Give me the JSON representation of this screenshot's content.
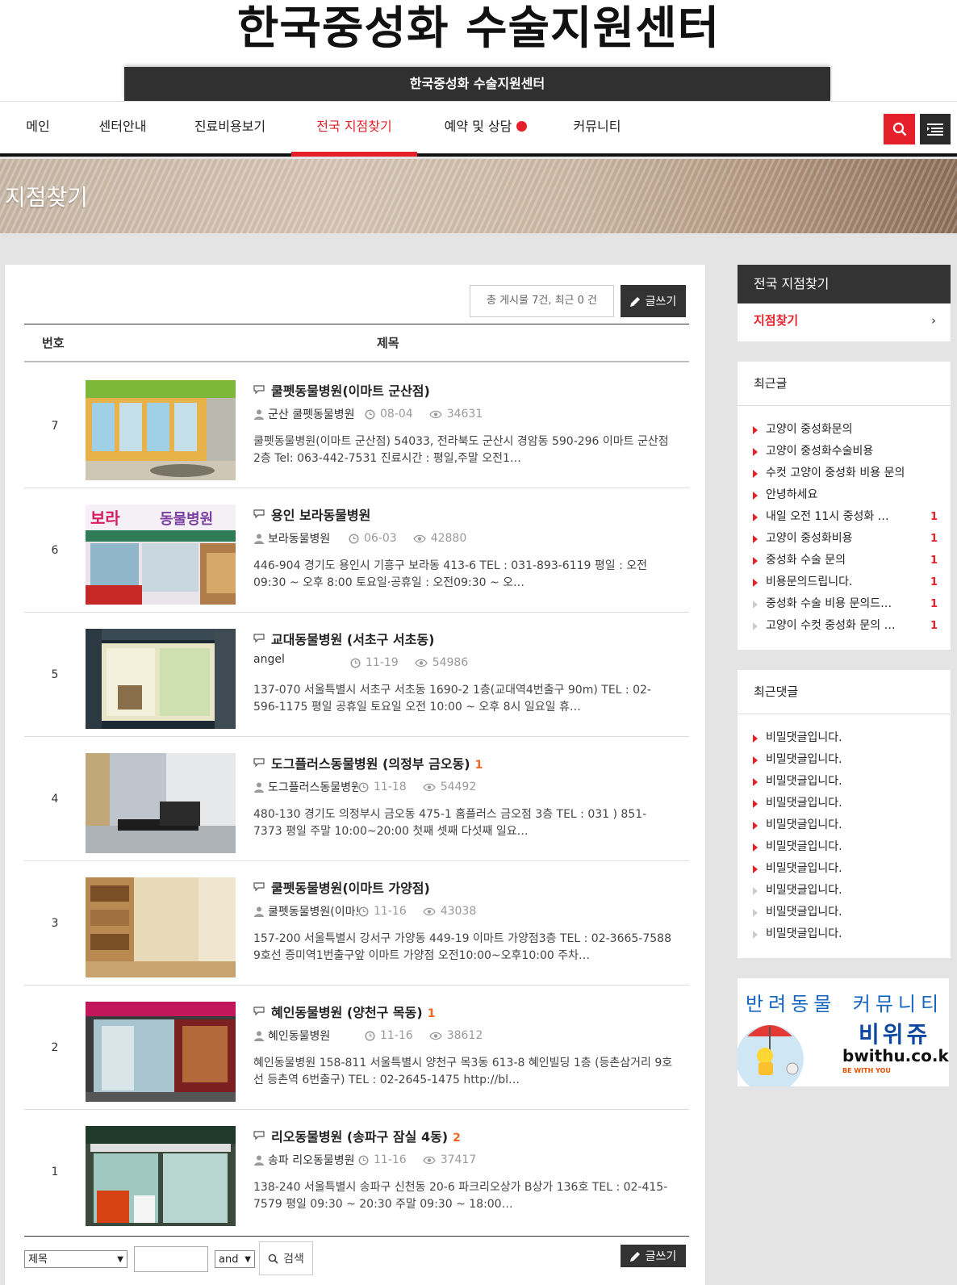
{
  "site": {
    "logo": "한국중성화 수술지원센터",
    "sub_title": "한국중성화 수술지원센터"
  },
  "nav": {
    "items": [
      {
        "label": "메인",
        "active": false
      },
      {
        "label": "센터안내",
        "active": false
      },
      {
        "label": "진료비용보기",
        "active": false
      },
      {
        "label": "전국 지점찾기",
        "active": true
      },
      {
        "label": "예약 및 상담",
        "active": false
      },
      {
        "label": "커뮤니티",
        "active": false
      }
    ],
    "search_icon": "search-icon",
    "menu_icon": "menu-icon"
  },
  "banner": {
    "title": "지점찾기"
  },
  "board": {
    "count_text": "총 게시물 7건, 최근 0 건",
    "write_label": "글쓰기",
    "col_num": "번호",
    "col_title": "제목",
    "posts": [
      {
        "num": "7",
        "title": "쿨펫동물병원(이마트 군산점)",
        "comments": "",
        "author": "군산 쿨펫동물병원",
        "date": "08-04",
        "hits": "34631",
        "summary": "쿨펫동물병원(이마트 군산점) 54033, 전라북도 군산시 경암동 590-296 이마트 군산점 2층 Tel: 063-442-7531 진료시간 : 평일,주말 오전1…"
      },
      {
        "num": "6",
        "title": "용인 보라동물병원",
        "comments": "",
        "author": "보라동물병원",
        "date": "06-03",
        "hits": "42880",
        "summary": "446-904 경기도 용인시 기흥구 보라동 413-6 TEL : 031-893-6119 평일 : 오전 09:30 ~ 오후 8:00 토요일·공휴일 : 오전09:30 ~ 오…"
      },
      {
        "num": "5",
        "title": "교대동물병원 (서초구 서초동)",
        "comments": "",
        "author": "angel",
        "date": "11-19",
        "hits": "54986",
        "summary": "137-070 서울특별시 서초구 서초동 1690-2 1층(교대역4번출구 90m) TEL : 02-596-1175 평일 공휴일 토요일 오전 10:00 ~ 오후 8시 일요일 휴…"
      },
      {
        "num": "4",
        "title": "도그플러스동물병원 (의정부 금오동)",
        "comments": "1",
        "author": "도그플러스동물병원",
        "date": "11-18",
        "hits": "54492",
        "summary": "480-130 경기도 의정부시 금오동 475-1 홈플러스 금오점 3층 TEL : 031 ) 851-7373 평일 주말 10:00~20:00 첫째 셋째 다섯째 일요…"
      },
      {
        "num": "3",
        "title": "쿨펫동물병원(이마트 가양점)",
        "comments": "",
        "author": "쿨펫동물병원(이마트 가양점)",
        "date": "11-16",
        "hits": "43038",
        "summary": "157-200 서울특별시 강서구 가양동 449-19 이마트 가양점3층 TEL : 02-3665-7588 9호선 증미역1번출구앞 이마트 가양점 오전10:00~오후10:00 주차…"
      },
      {
        "num": "2",
        "title": "혜인동물병원 (양천구 목동)",
        "comments": "1",
        "author": "혜인동물병원",
        "date": "11-16",
        "hits": "38612",
        "summary": "혜인동물병원 158-811 서울특별시 양천구 목3동 613-8 혜인빌딩 1층 (등촌삼거리 9호선 등촌역 6번출구) TEL : 02-2645-1475 http://bl…"
      },
      {
        "num": "1",
        "title": "리오동물병원 (송파구 잠실 4동)",
        "comments": "2",
        "author": "송파 리오동물병원",
        "date": "11-16",
        "hits": "37417",
        "summary": "138-240 서울특별시 송파구 신천동 20-6 파크리오상가 B상가 136호 TEL : 02-415-7579 평일 09:30 ~ 20:30 주말 09:30 ~ 18:00…"
      }
    ],
    "search": {
      "field_option": "제목",
      "op_option": "and",
      "query": "",
      "button": "검색"
    }
  },
  "sidebar": {
    "branch": {
      "title": "전국 지점찾기",
      "item": "지점찾기"
    },
    "recent_posts": {
      "title": "최근글",
      "items": [
        {
          "text": "고양이 중성화문의",
          "badge": ""
        },
        {
          "text": "고양이 중성화수술비용",
          "badge": ""
        },
        {
          "text": "수컷 고양이 중성화 비용 문의",
          "badge": ""
        },
        {
          "text": "안녕하세요",
          "badge": ""
        },
        {
          "text": "내일 오전 11시 중성화 …",
          "badge": "1"
        },
        {
          "text": "고양이 중성화비용",
          "badge": "1"
        },
        {
          "text": "중성화 수술 문의",
          "badge": "1"
        },
        {
          "text": "비용문의드립니다.",
          "badge": "1"
        },
        {
          "text": "중성화 수술 비용 문의드…",
          "badge": "1"
        },
        {
          "text": "고양이 수컷 중성화 문의 …",
          "badge": "1"
        }
      ]
    },
    "recent_comments": {
      "title": "최근댓글",
      "items": [
        "비밀댓글입니다.",
        "비밀댓글입니다.",
        "비밀댓글입니다.",
        "비밀댓글입니다.",
        "비밀댓글입니다.",
        "비밀댓글입니다.",
        "비밀댓글입니다.",
        "비밀댓글입니다.",
        "비밀댓글입니다.",
        "비밀댓글입니다."
      ]
    },
    "ad": {
      "line1": "반려동물 커뮤니티",
      "line2": "비위쥬",
      "url": "bwithu.co.kr",
      "tag": "BE WITH YOU"
    }
  },
  "colors": {
    "accent": "#e5202a",
    "dark": "#333333",
    "comment": "#f26522"
  }
}
